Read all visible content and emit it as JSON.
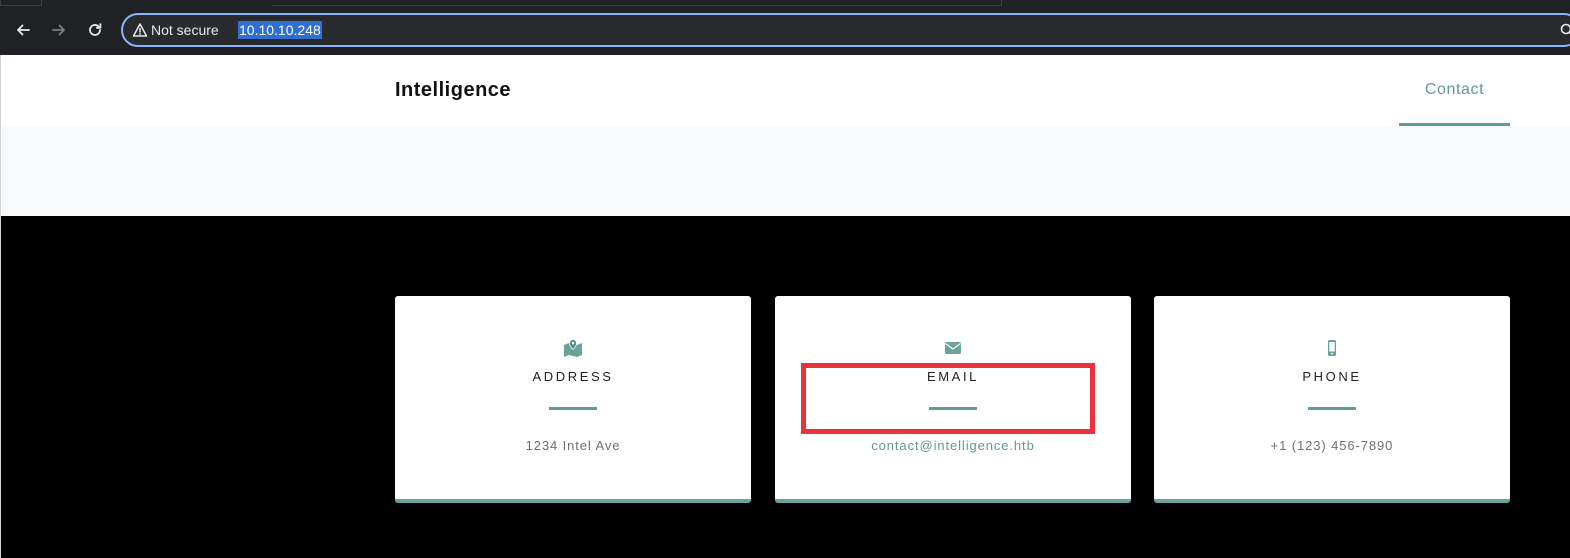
{
  "browser": {
    "security_label": "Not secure",
    "url": "10.10.10.248"
  },
  "site": {
    "brand": "Intelligence",
    "nav": [
      {
        "label": "Contact",
        "active": true
      }
    ]
  },
  "contact_cards": [
    {
      "icon": "map-marker-icon",
      "title": "ADDRESS",
      "value": "1234 Intel Ave"
    },
    {
      "icon": "envelope-icon",
      "title": "EMAIL",
      "value": "contact@intelligence.htb"
    },
    {
      "icon": "mobile-phone-icon",
      "title": "PHONE",
      "value": "+1 (123) 456-7890"
    }
  ],
  "colors": {
    "accent": "#5e9c95",
    "highlight": "#e8333b",
    "chrome_bg": "#202124",
    "omnibox_border": "#8ab4f8"
  }
}
